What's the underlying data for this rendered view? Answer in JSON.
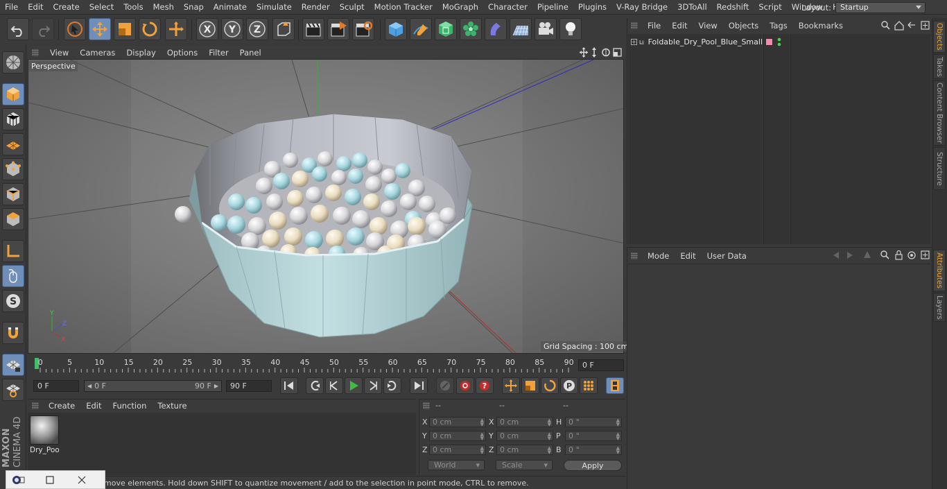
{
  "menu": {
    "items": [
      "File",
      "Edit",
      "Create",
      "Select",
      "Tools",
      "Mesh",
      "Snap",
      "Animate",
      "Simulate",
      "Render",
      "Sculpt",
      "Motion Tracker",
      "MoGraph",
      "Character",
      "Pipeline",
      "Plugins",
      "V-Ray Bridge",
      "3DToAll",
      "Redshift",
      "Script",
      "Window",
      "Help"
    ],
    "layout_label": "Layout:",
    "layout_value": "Startup"
  },
  "viewport": {
    "menu": [
      "View",
      "Cameras",
      "Display",
      "Options",
      "Filter",
      "Panel"
    ],
    "camera_label": "Perspective",
    "grid_spacing": "Grid Spacing : 100 cm",
    "axis_x": "X",
    "axis_y": "Y",
    "axis_z": "Z"
  },
  "timeline": {
    "ticks": [
      "0",
      "5",
      "10",
      "15",
      "20",
      "25",
      "30",
      "35",
      "40",
      "45",
      "50",
      "55",
      "60",
      "65",
      "70",
      "75",
      "80",
      "85",
      "90"
    ],
    "current_frame": "0 F"
  },
  "transport": {
    "start_field": "0 F",
    "range_min": "0 F",
    "range_max": "90 F",
    "end_field": "90 F"
  },
  "material_manager": {
    "menu": [
      "Create",
      "Edit",
      "Function",
      "Texture"
    ],
    "material_name": "Dry_Poo"
  },
  "coordinates": {
    "headers": [
      "--",
      "--",
      "--"
    ],
    "rows": [
      {
        "l1": "X",
        "v1": "0 cm",
        "l2": "X",
        "v2": "0 cm",
        "l3": "H",
        "v3": "0 °"
      },
      {
        "l1": "Y",
        "v1": "0 cm",
        "l2": "Y",
        "v2": "0 cm",
        "l3": "P",
        "v3": "0 °"
      },
      {
        "l1": "Z",
        "v1": "0 cm",
        "l2": "Z",
        "v2": "0 cm",
        "l3": "B",
        "v3": "0 °"
      }
    ],
    "space_dropdown": "World",
    "mode_dropdown": "Scale",
    "apply_label": "Apply"
  },
  "status_bar": {
    "text": "move elements. Hold down SHIFT to quantize movement / add to the selection in point mode, CTRL to remove."
  },
  "object_manager": {
    "menu": [
      "File",
      "Edit",
      "View",
      "Objects",
      "Tags",
      "Bookmarks"
    ],
    "object_name": "Foldable_Dry_Pool_Blue_Small"
  },
  "attributes": {
    "menu": [
      "Mode",
      "Edit",
      "User Data"
    ]
  },
  "right_tabs": [
    "Objects",
    "Takes",
    "Content Browser",
    "Structure",
    "Attributes",
    "Layers"
  ],
  "logo": {
    "brand": "MAXON",
    "product": "CINEMA 4D"
  },
  "colors": {
    "accent_blue": "#6f8fb8",
    "active_tab": "#e8a33a",
    "pool_fabric": "#aac9cc"
  }
}
